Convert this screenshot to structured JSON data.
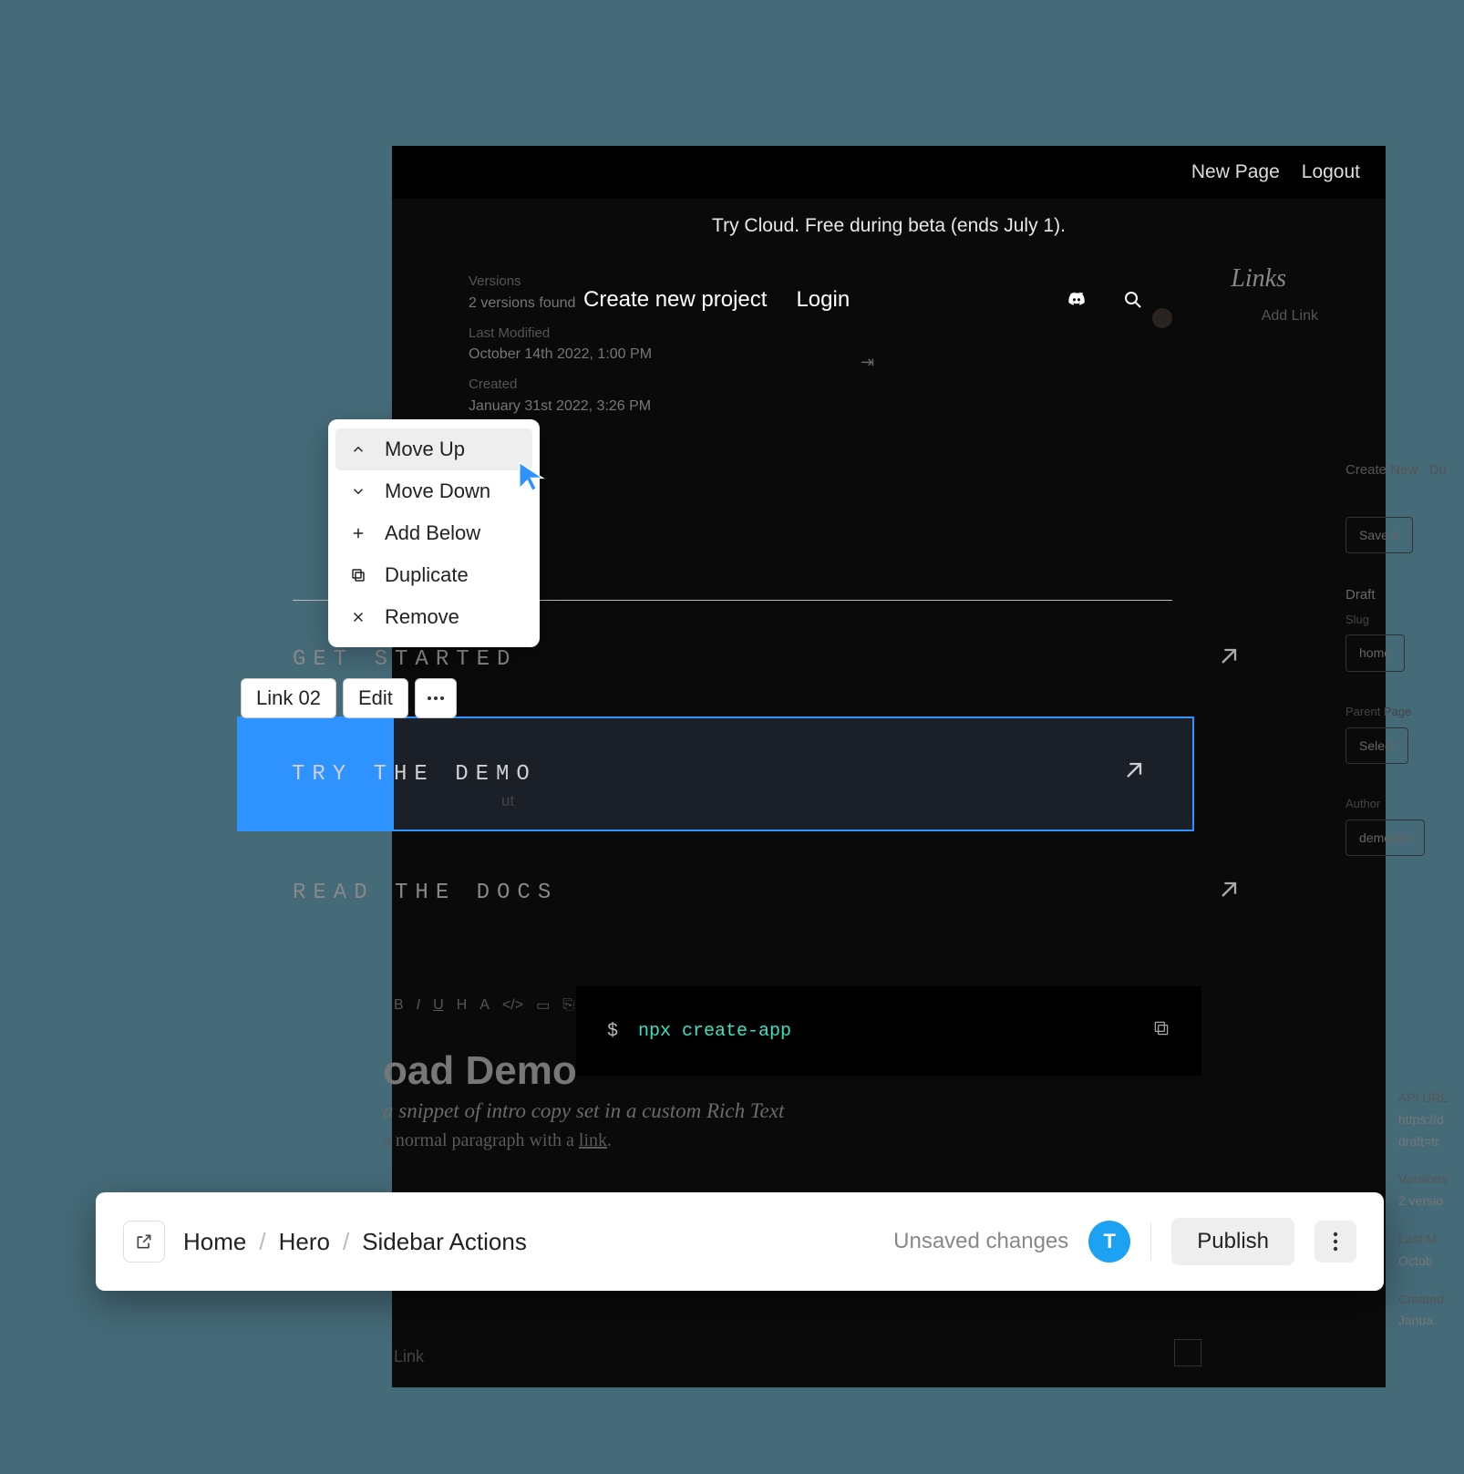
{
  "topbar": {
    "new_page": "New Page",
    "logout": "Logout"
  },
  "promo": "Try Cloud. Free during beta (ends July 1).",
  "dim": {
    "versions_label": "Versions",
    "versions_found": "2 versions found",
    "last_modified_label": "Last Modified",
    "last_modified_val": "October 14th 2022, 1:00 PM",
    "created_label": "Created",
    "created_val": "January 31st 2022, 3:26 PM"
  },
  "nav": {
    "create": "Create new project",
    "login": "Login",
    "discord_icon": "discord",
    "search_icon": "search"
  },
  "links_panel": {
    "heading": "Links",
    "add_link": "Add Link"
  },
  "right": {
    "create_new": "Create New",
    "duplicate_short": "Du",
    "save": "Save d",
    "draft": "Draft",
    "slug": "Slug",
    "home": "home",
    "parent_page": "Parent Page",
    "select": "Select",
    "author": "Author",
    "author_val": "demo@p"
  },
  "context_menu": {
    "items": [
      {
        "icon": "chevron-up",
        "label": "Move Up",
        "hovered": true
      },
      {
        "icon": "chevron-down",
        "label": "Move Down"
      },
      {
        "icon": "plus",
        "label": "Add Below"
      },
      {
        "icon": "copy",
        "label": "Duplicate"
      },
      {
        "icon": "x",
        "label": "Remove"
      }
    ]
  },
  "links": {
    "row1": "GET STARTED",
    "row2": "TRY THE DEMO",
    "row3": "READ THE DOCS"
  },
  "out_label": "ut",
  "chips": {
    "link": "Link 02",
    "edit": "Edit"
  },
  "demo": {
    "title": "oad Demo",
    "line1": "a snippet of intro copy set in a custom Rich Text",
    "line2_a": "a normal paragraph with a ",
    "line2_b": "link",
    "line2_c": "."
  },
  "terminal": {
    "prompt": "$",
    "cmd": "npx create-app"
  },
  "bottom_right": {
    "api_url": "API URL",
    "url": "https://d",
    "draft": "draft=tr",
    "versions": "Versions",
    "vfound": "2 versio",
    "last": "Last M",
    "oct": "Octob",
    "created": "Created",
    "jan": "Janua"
  },
  "bottombar": {
    "breadcrumb": [
      "Home",
      "Hero",
      "Sidebar Actions"
    ],
    "status": "Unsaved changes",
    "user_initial": "T",
    "publish": "Publish"
  },
  "faint": {
    "link": "Link"
  }
}
